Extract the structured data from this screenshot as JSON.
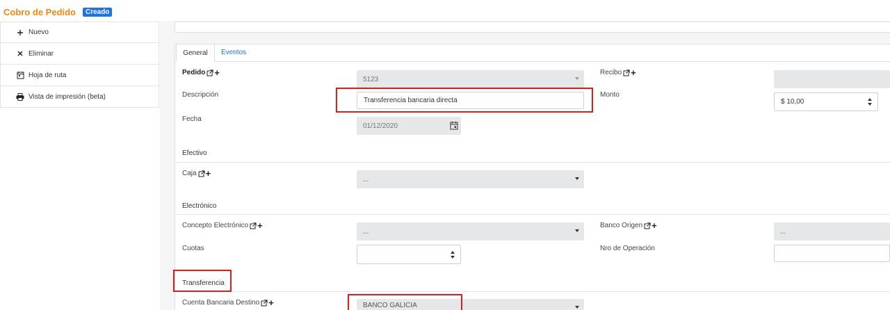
{
  "header": {
    "title": "Cobro de Pedido",
    "badge": "Creado"
  },
  "sidebar": {
    "items": [
      {
        "label": "Nuevo",
        "icon": "plus-icon"
      },
      {
        "label": "Eliminar",
        "icon": "close-icon"
      },
      {
        "label": "Hoja de ruta",
        "icon": "calendar-icon"
      },
      {
        "label": "Vista de impresión (beta)",
        "icon": "printer-icon"
      }
    ]
  },
  "tabs": [
    {
      "label": "General",
      "active": true
    },
    {
      "label": "Eventos",
      "active": false
    }
  ],
  "form": {
    "pedido": {
      "label": "Pedido",
      "value": "5123"
    },
    "recibo": {
      "label": "Recibo",
      "value": ""
    },
    "descripcion": {
      "label": "Descripción",
      "value": "Transferencia bancaria directa"
    },
    "monto": {
      "label": "Monto",
      "value": "$ 10,00"
    },
    "fecha": {
      "label": "Fecha",
      "value": "01/12/2020"
    },
    "efectivo": {
      "section": "Efectivo"
    },
    "caja": {
      "label": "Caja",
      "value": "..."
    },
    "electronico": {
      "section": "Electrónico"
    },
    "concepto_electronico": {
      "label": "Concepto Electrónico",
      "value": "..."
    },
    "banco_origen": {
      "label": "Banco Origen",
      "value": "..."
    },
    "cuotas": {
      "label": "Cuotas",
      "value": ""
    },
    "nro_operacion": {
      "label": "Nro de Operación",
      "value": ""
    },
    "transferencia": {
      "section": "Transferencia"
    },
    "cuenta_bancaria_destino": {
      "label": "Cuenta Bancaria Destino",
      "value": "BANCO GALICIA"
    }
  },
  "colors": {
    "title": "#f0870f",
    "badge": "#1a73e8",
    "tab_link": "#1a73e8",
    "highlight": "#e01b1b"
  }
}
